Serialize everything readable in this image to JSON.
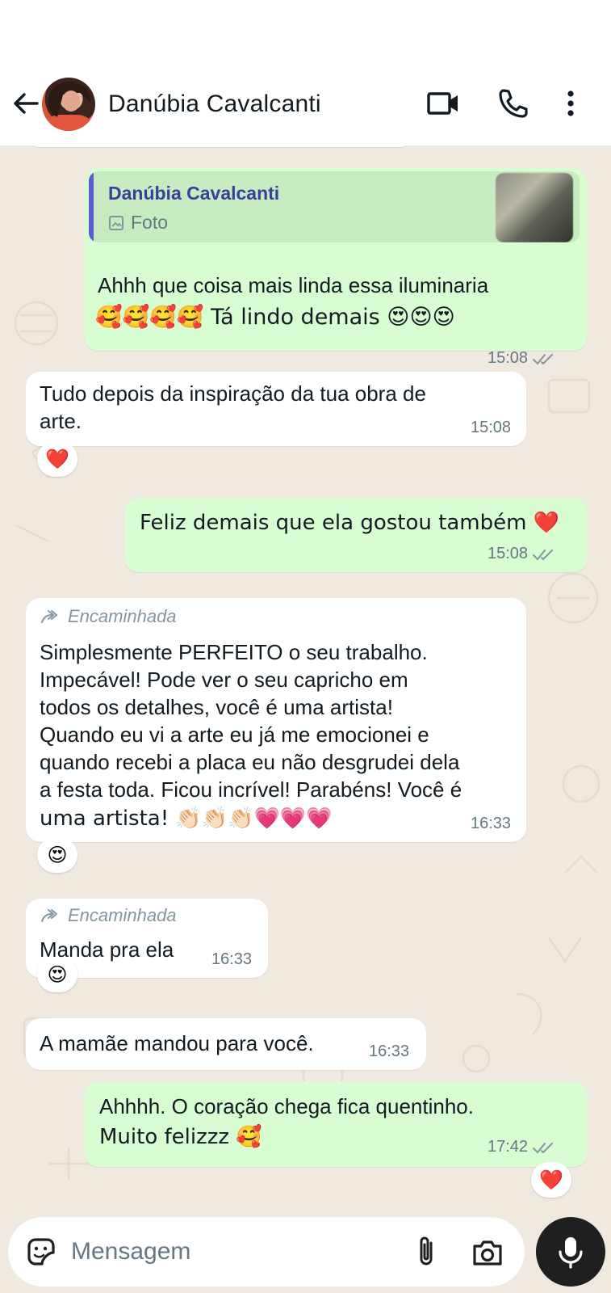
{
  "header": {
    "contact_name": "Danúbia Cavalcanti",
    "icons": [
      "back-arrow-icon",
      "video-call-icon",
      "phone-icon",
      "more-vertical-icon"
    ]
  },
  "messages": [
    {
      "direction": "out",
      "quote": {
        "name": "Danúbia Cavalcanti",
        "type_label": "Foto"
      },
      "text": "Ahhh que coisa mais linda essa iluminaria 🥰🥰🥰🥰 Tá lindo demais 😍😍😍",
      "line1": "Ahhh que coisa mais linda essa iluminaria",
      "line2": "🥰🥰🥰🥰 Tá lindo demais 😍😍😍",
      "time": "15:08",
      "status": "read"
    },
    {
      "direction": "in",
      "line1": "Tudo depois da inspiração da tua obra de",
      "line2": "arte.",
      "time": "15:08",
      "reaction": "❤️"
    },
    {
      "direction": "out",
      "line1": "Feliz demais que ela gostou também ❤️",
      "time": "15:08",
      "status": "read"
    },
    {
      "direction": "in",
      "forwarded_label": "Encaminhada",
      "lines": [
        "Simplesmente PERFEITO o seu trabalho.",
        "Impecável! Pode ver o seu capricho em",
        "todos os detalhes, você é uma artista!",
        "Quando eu vi a arte eu já me emocionei e",
        "quando recebi a placa eu não desgrudei dela",
        "a festa toda. Ficou incrível! Parabéns! Você é",
        "uma artista! 👏🏻👏🏻👏🏻💗💗💗"
      ],
      "time": "16:33",
      "reaction": "😍"
    },
    {
      "direction": "in",
      "forwarded_label": "Encaminhada",
      "line1": "Manda pra ela",
      "time": "16:33",
      "reaction": "😍"
    },
    {
      "direction": "in",
      "line1": "A mamãe mandou para você.",
      "time": "16:33"
    },
    {
      "direction": "out",
      "line1": "Ahhhh. O coração chega fica quentinho.",
      "line2": "Muito felizzz 🥰",
      "time": "17:42",
      "status": "read",
      "reaction": "❤️"
    }
  ],
  "composer": {
    "placeholder": "Mensagem",
    "icons": [
      "sticker-icon",
      "attach-clip-icon",
      "camera-icon",
      "microphone-icon"
    ]
  },
  "colors": {
    "outgoing_bubble": "#d9fdd3",
    "incoming_bubble": "#ffffff",
    "chat_background": "#efe9df",
    "quote_accent": "#5a5ed6",
    "mic_button": "#1f1f1f"
  }
}
